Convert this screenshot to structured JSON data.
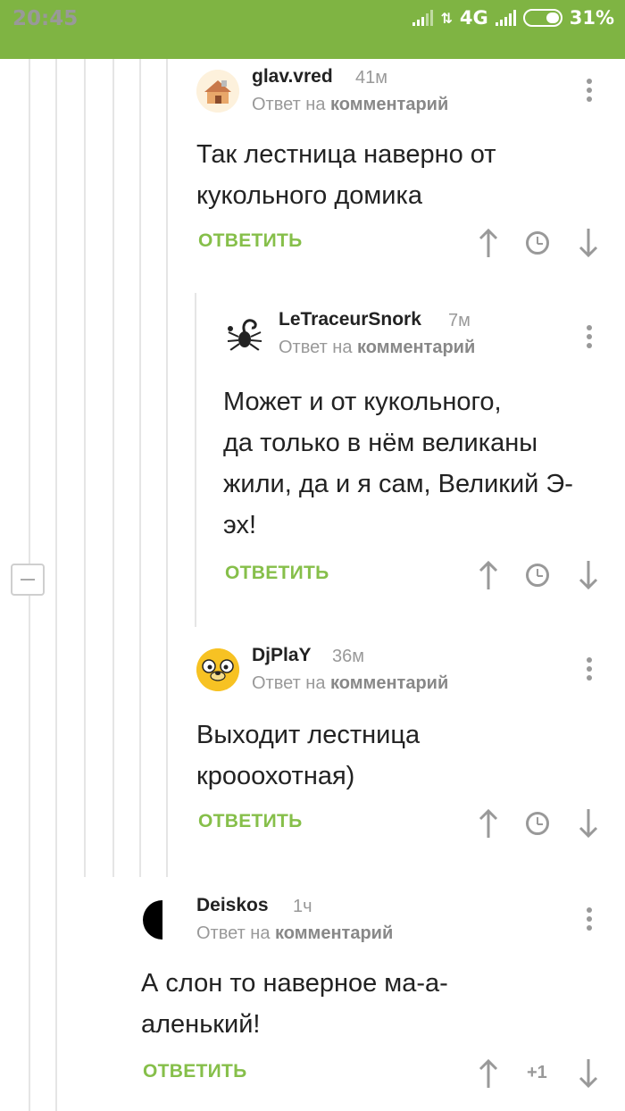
{
  "status_bar": {
    "time": "20:45",
    "network": "4G",
    "battery": "31%"
  },
  "reply_prefix": "Ответ на ",
  "reply_target": "комментарий",
  "reply_label": "ОТВЕТИТЬ",
  "comments": [
    {
      "author": "glav.vred",
      "time": "41м",
      "text_lines": [
        "Так лестница наверно от",
        "кукольного домика"
      ]
    },
    {
      "author": "LeTraceurSnork",
      "time": "7м",
      "text_lines": [
        "Может и от кукольного,",
        "да только в нём великаны",
        "жили, да и я сам, Великий Э-",
        "эх!"
      ]
    },
    {
      "author": "DjPlaY",
      "time": "36м",
      "text_lines": [
        "Выходит лестница",
        "крооохотная)"
      ]
    },
    {
      "author": "Deiskos",
      "time": "1ч",
      "text_lines": [
        "А слон то наверное ма-а-",
        "аленький!"
      ],
      "score": "+1"
    }
  ]
}
